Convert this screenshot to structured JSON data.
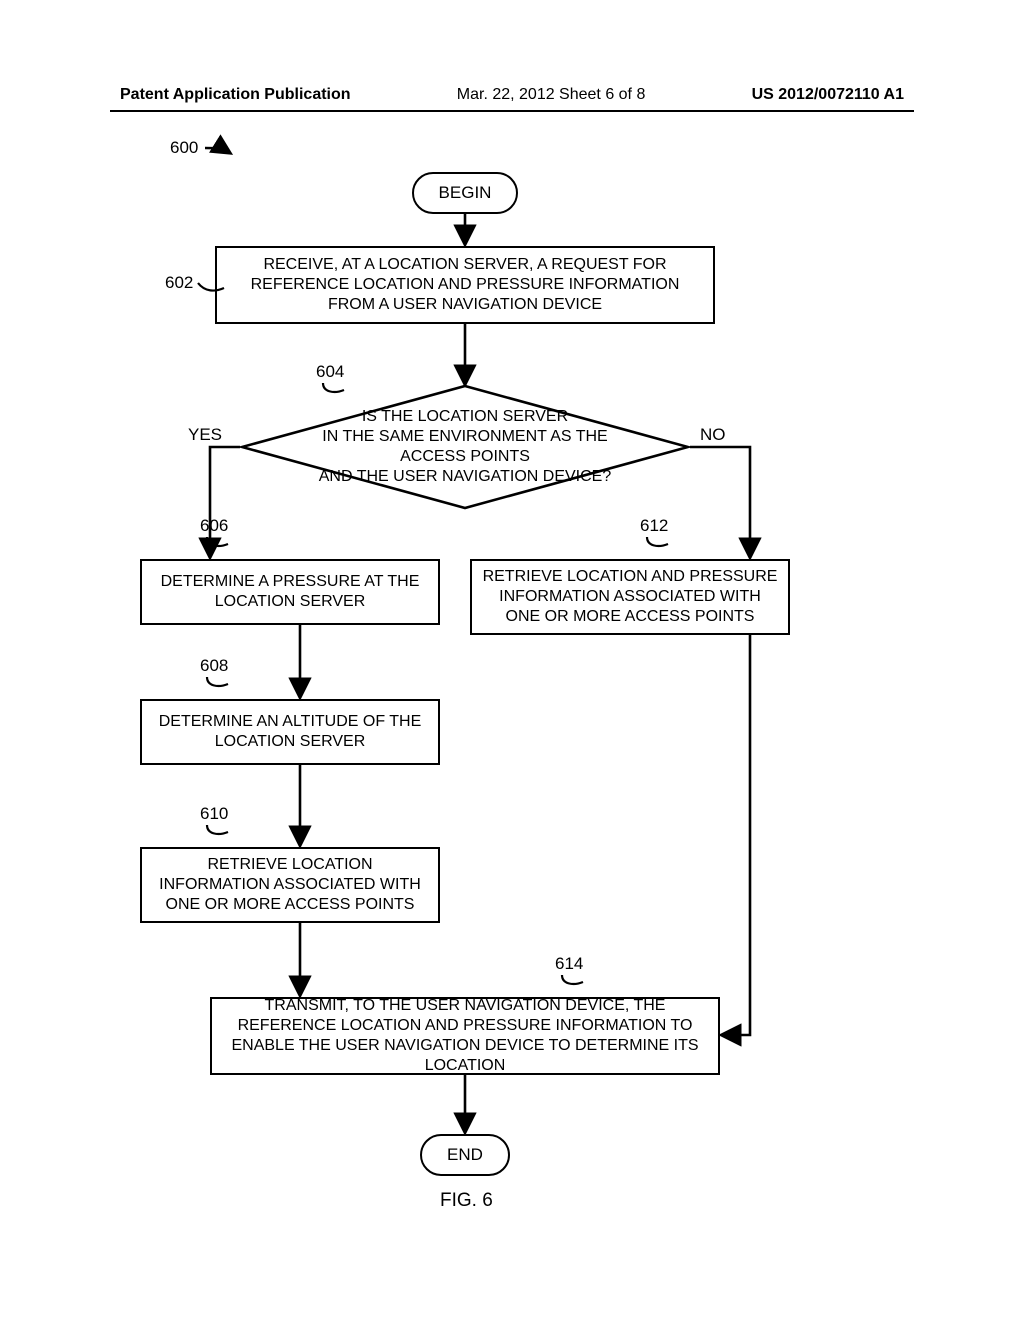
{
  "header": {
    "left": "Patent Application Publication",
    "mid": "Mar. 22, 2012  Sheet 6 of 8",
    "right": "US 2012/0072110 A1"
  },
  "refs": {
    "r600": "600",
    "r602": "602",
    "r604": "604",
    "r606": "606",
    "r608": "608",
    "r610": "610",
    "r612": "612",
    "r614": "614"
  },
  "labels": {
    "yes": "YES",
    "no": "NO"
  },
  "nodes": {
    "begin": "BEGIN",
    "n602": "RECEIVE, AT A LOCATION SERVER, A REQUEST FOR REFERENCE LOCATION AND PRESSURE INFORMATION FROM A USER NAVIGATION DEVICE",
    "n604": "IS THE LOCATION SERVER\nIN THE SAME ENVIRONMENT AS THE ACCESS POINTS\nAND THE USER NAVIGATION DEVICE?",
    "n606": "DETERMINE A PRESSURE AT THE LOCATION SERVER",
    "n608": "DETERMINE AN ALTITUDE OF THE LOCATION SERVER",
    "n610": "RETRIEVE LOCATION INFORMATION ASSOCIATED WITH ONE OR MORE ACCESS POINTS",
    "n612": "RETRIEVE LOCATION AND PRESSURE INFORMATION ASSOCIATED WITH ONE OR MORE ACCESS POINTS",
    "n614": "TRANSMIT, TO THE USER NAVIGATION DEVICE, THE REFERENCE LOCATION AND PRESSURE INFORMATION TO ENABLE THE USER NAVIGATION DEVICE TO DETERMINE ITS LOCATION",
    "end": "END"
  },
  "caption": "FIG. 6"
}
